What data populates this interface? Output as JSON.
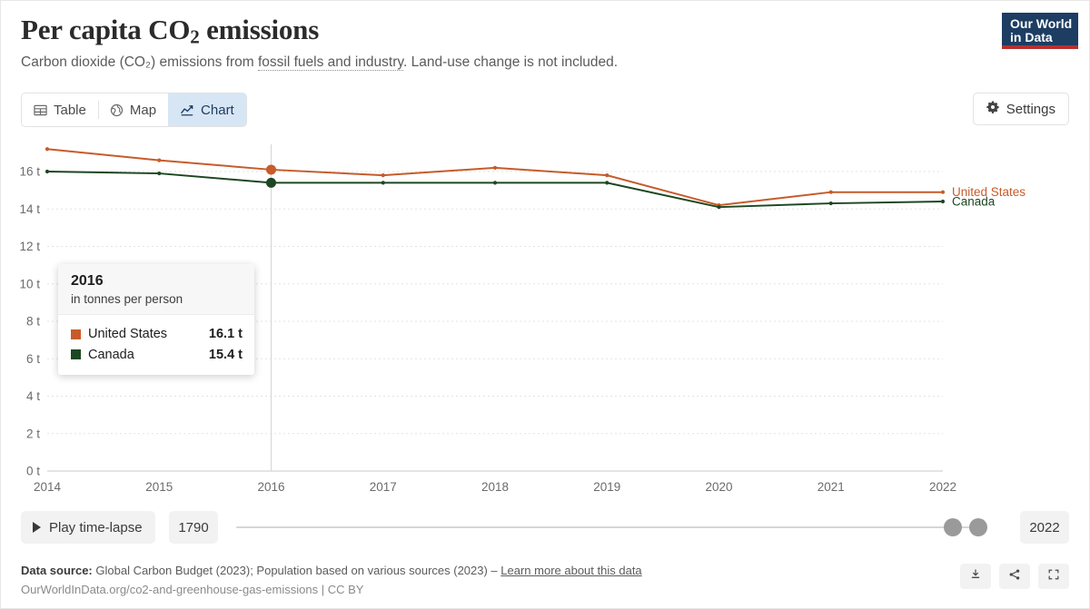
{
  "header": {
    "title_main": "Per capita CO",
    "title_sub": "2",
    "title_tail": " emissions",
    "subtitle_pre": "Carbon dioxide (CO₂) emissions from ",
    "subtitle_link": "fossil fuels and industry",
    "subtitle_post": ". Land-use change is not included.",
    "logo_line1": "Our World",
    "logo_line2": "in Data"
  },
  "tabs": [
    {
      "label": "Table",
      "icon": "table-icon",
      "active": false
    },
    {
      "label": "Map",
      "icon": "globe-icon",
      "active": false
    },
    {
      "label": "Chart",
      "icon": "line-chart-icon",
      "active": true
    }
  ],
  "settings": {
    "label": "Settings",
    "icon": "gear-icon"
  },
  "tooltip": {
    "year": "2016",
    "unit": "in tonnes per person",
    "rows": [
      {
        "name": "United States",
        "value": "16.1 t",
        "color": "#c75b2a"
      },
      {
        "name": "Canada",
        "value": "15.4 t",
        "color": "#1d4722"
      }
    ]
  },
  "timeline": {
    "play_label": "Play time-lapse",
    "start_year": "1790",
    "end_year": "2022"
  },
  "footer": {
    "source_label": "Data source:",
    "source_text": "Global Carbon Budget (2023); Population based on various sources (2023) – ",
    "learn_more": "Learn more about this data",
    "attribution": "OurWorldInData.org/co2-and-greenhouse-gas-emissions | CC BY",
    "actions": [
      {
        "name": "download-icon"
      },
      {
        "name": "share-icon"
      },
      {
        "name": "expand-icon"
      }
    ]
  },
  "chart_data": {
    "type": "line",
    "title": "Per capita CO2 emissions",
    "subtitle": "Carbon dioxide (CO2) emissions from fossil fuels and industry. Land-use change is not included.",
    "xlabel": "",
    "ylabel": "",
    "unit": "t",
    "x": [
      2014,
      2015,
      2016,
      2017,
      2018,
      2019,
      2020,
      2021,
      2022
    ],
    "xtick_labels": [
      "2014",
      "2015",
      "2016",
      "2017",
      "2018",
      "2019",
      "2020",
      "2021",
      "2022"
    ],
    "ytick_labels": [
      "0 t",
      "2 t",
      "4 t",
      "6 t",
      "8 t",
      "10 t",
      "12 t",
      "14 t",
      "16 t"
    ],
    "yticks": [
      0,
      2,
      4,
      6,
      8,
      10,
      12,
      14,
      16
    ],
    "ylim": [
      0,
      16.8
    ],
    "xlim": [
      2014,
      2022
    ],
    "grid": true,
    "legend_position": "right-inline",
    "highlight_year": 2016,
    "series": [
      {
        "name": "United States",
        "color": "#c75b2a",
        "values": [
          17.2,
          16.6,
          16.1,
          15.8,
          16.2,
          15.8,
          14.2,
          14.9,
          14.9
        ]
      },
      {
        "name": "Canada",
        "color": "#1d4722",
        "values": [
          16.0,
          15.9,
          15.4,
          15.4,
          15.4,
          15.4,
          14.1,
          14.3,
          14.4
        ]
      }
    ]
  }
}
